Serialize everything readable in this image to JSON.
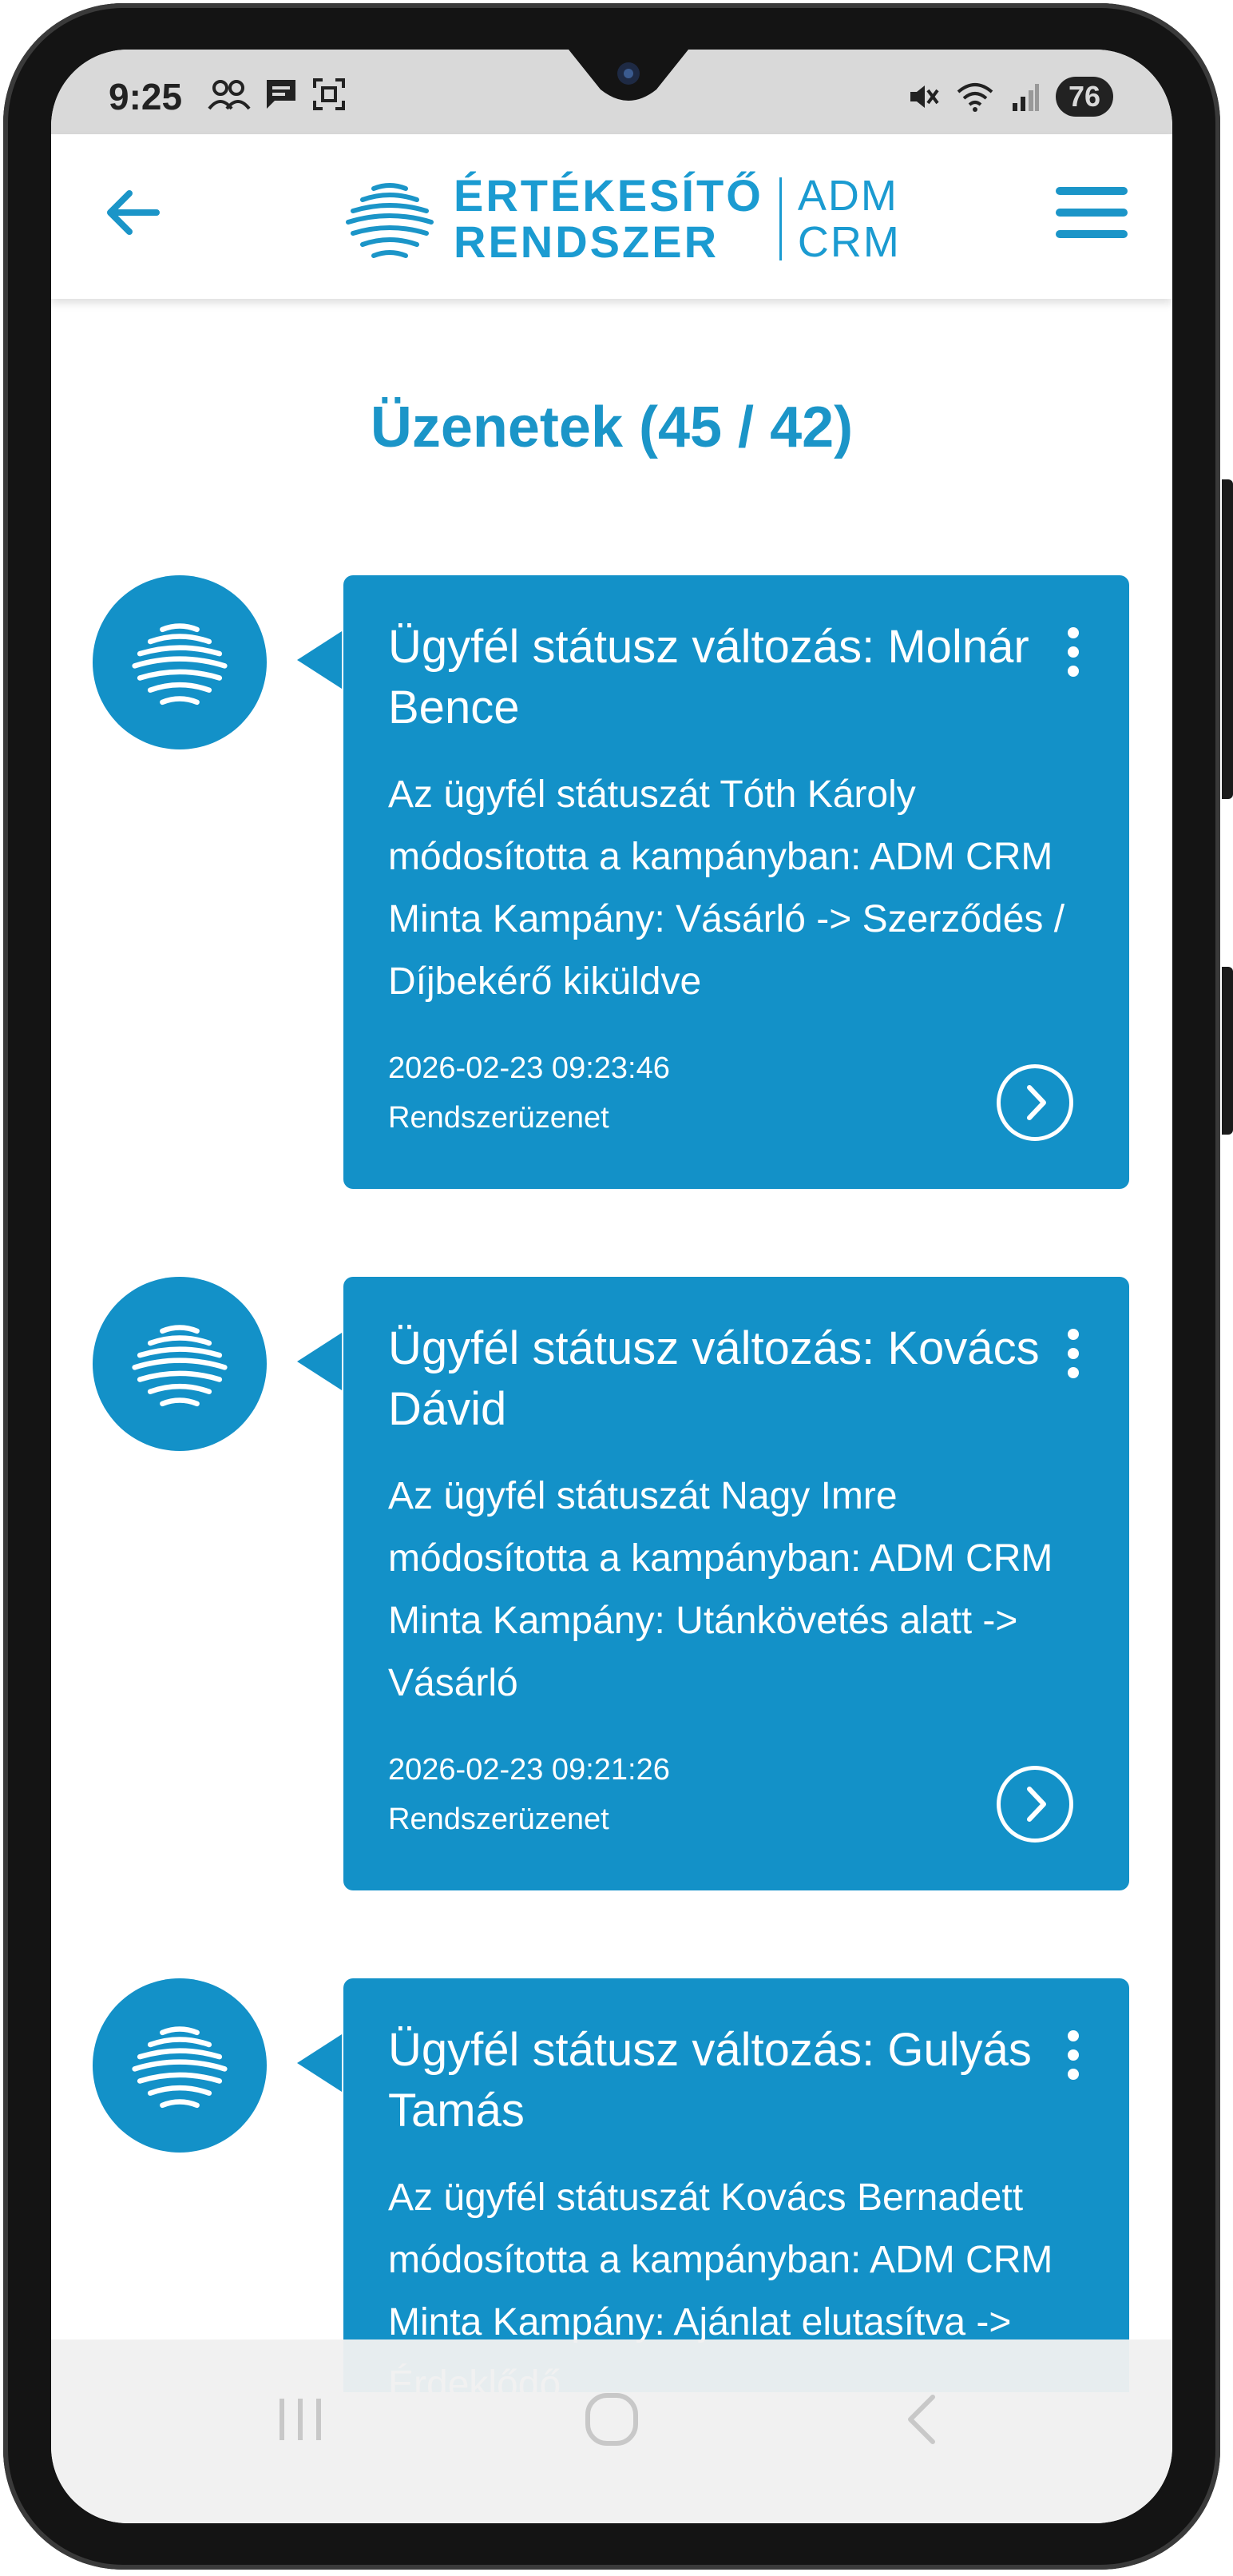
{
  "status_bar": {
    "time": "9:25",
    "battery": "76"
  },
  "app_bar": {
    "logo_line1": "ÉRTÉKESÍTŐ",
    "logo_line2": "RENDSZER",
    "logo_right1": "ADM",
    "logo_right2": "CRM"
  },
  "page": {
    "title": "Üzenetek (45 / 42)"
  },
  "messages": [
    {
      "title": "Ügyfél státusz változás: Molnár Bence",
      "body": "Az ügyfél státuszát Tóth Károly módosította a kampányban: ADM CRM Minta Kampány: Vásárló -> Szerződés / Díjbekérő kiküldve",
      "timestamp": "2026-02-23 09:23:46",
      "sender": "Rendszerüzenet"
    },
    {
      "title": "Ügyfél státusz változás: Kovács Dávid",
      "body": "Az ügyfél státuszát Nagy Imre módosította a kampányban: ADM CRM Minta Kampány: Utánkövetés alatt -> Vásárló",
      "timestamp": "2026-02-23 09:21:26",
      "sender": "Rendszerüzenet"
    },
    {
      "title": "Ügyfél státusz változás: Gulyás Tamás",
      "body": "Az ügyfél státuszát Kovács Bernadett módosította a kampányban: ADM CRM Minta Kampány: Ajánlat elutasítva -> Érdeklődő",
      "timestamp": "",
      "sender": ""
    }
  ],
  "colors": {
    "accent": "#1391c8",
    "title": "#1b95c8"
  }
}
